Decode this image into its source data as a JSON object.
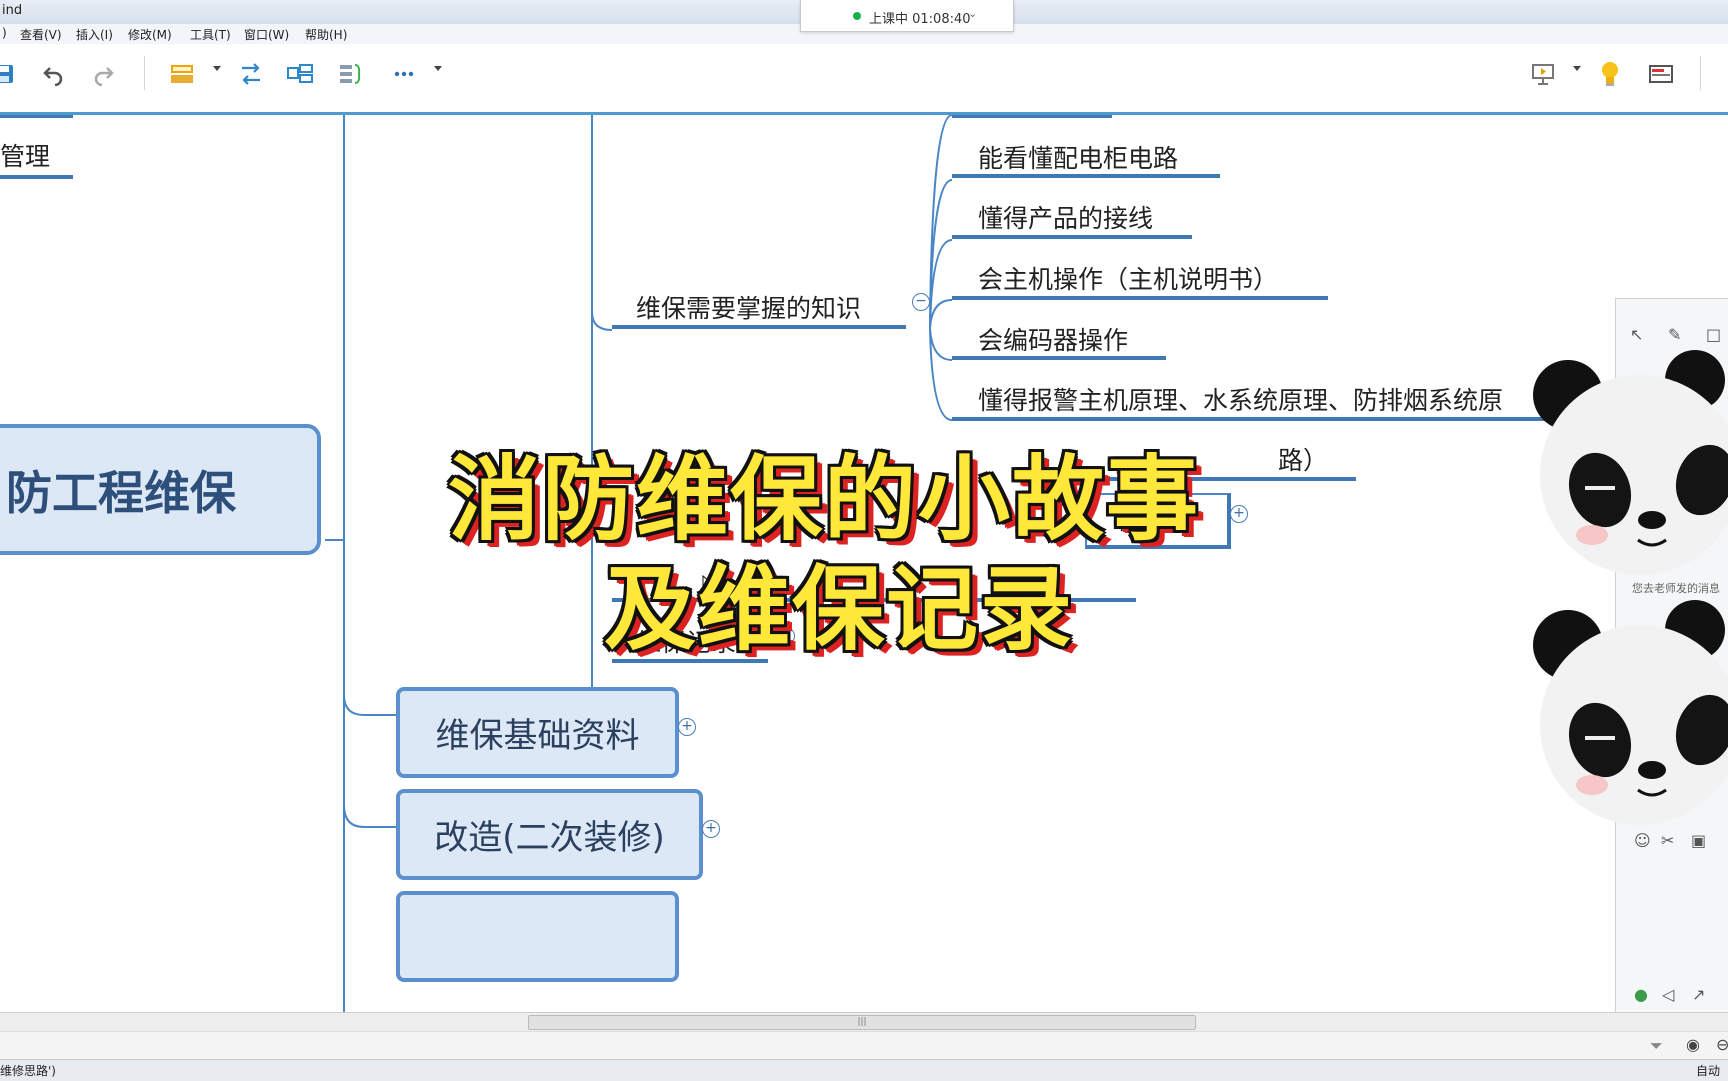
{
  "app": {
    "title": "ind"
  },
  "live": {
    "status": "上课中 01:08:40"
  },
  "menu": {
    "items": [
      ")",
      "查看(V)",
      "插入(I)",
      "修改(M)",
      "工具(T)",
      "窗口(W)",
      "帮助(H)"
    ]
  },
  "mindmap": {
    "left_partial_topic": "管理",
    "root_topic": "防工程维保",
    "branch_knowledge": "维保需要掌握的知识",
    "knowledge_items": [
      "能看懂配电柜电路",
      "懂得产品的接线",
      "会主机操作（主机说明书）",
      "会编码器操作",
      "懂得报警主机原理、水系统原理、防排烟系统原"
    ],
    "partial_item_a": "路）",
    "partial_item_b": "修思路",
    "branch_records": "维保记录",
    "box_basic_docs": "维保基础资料",
    "box_renovation": "改造(二次装修)"
  },
  "overlay": {
    "line1": "消防维保的小故事",
    "line2": "及维保记录"
  },
  "side_panel": {
    "message": "您去老师发的消息"
  },
  "status": {
    "bottom_left": "维修思路')",
    "bottom_right": "自动"
  },
  "colors": {
    "accent": "#3f78b5",
    "box_fill": "#dde8f7",
    "overlay_text": "#ffe83a",
    "overlay_shadow": "#d22222"
  }
}
